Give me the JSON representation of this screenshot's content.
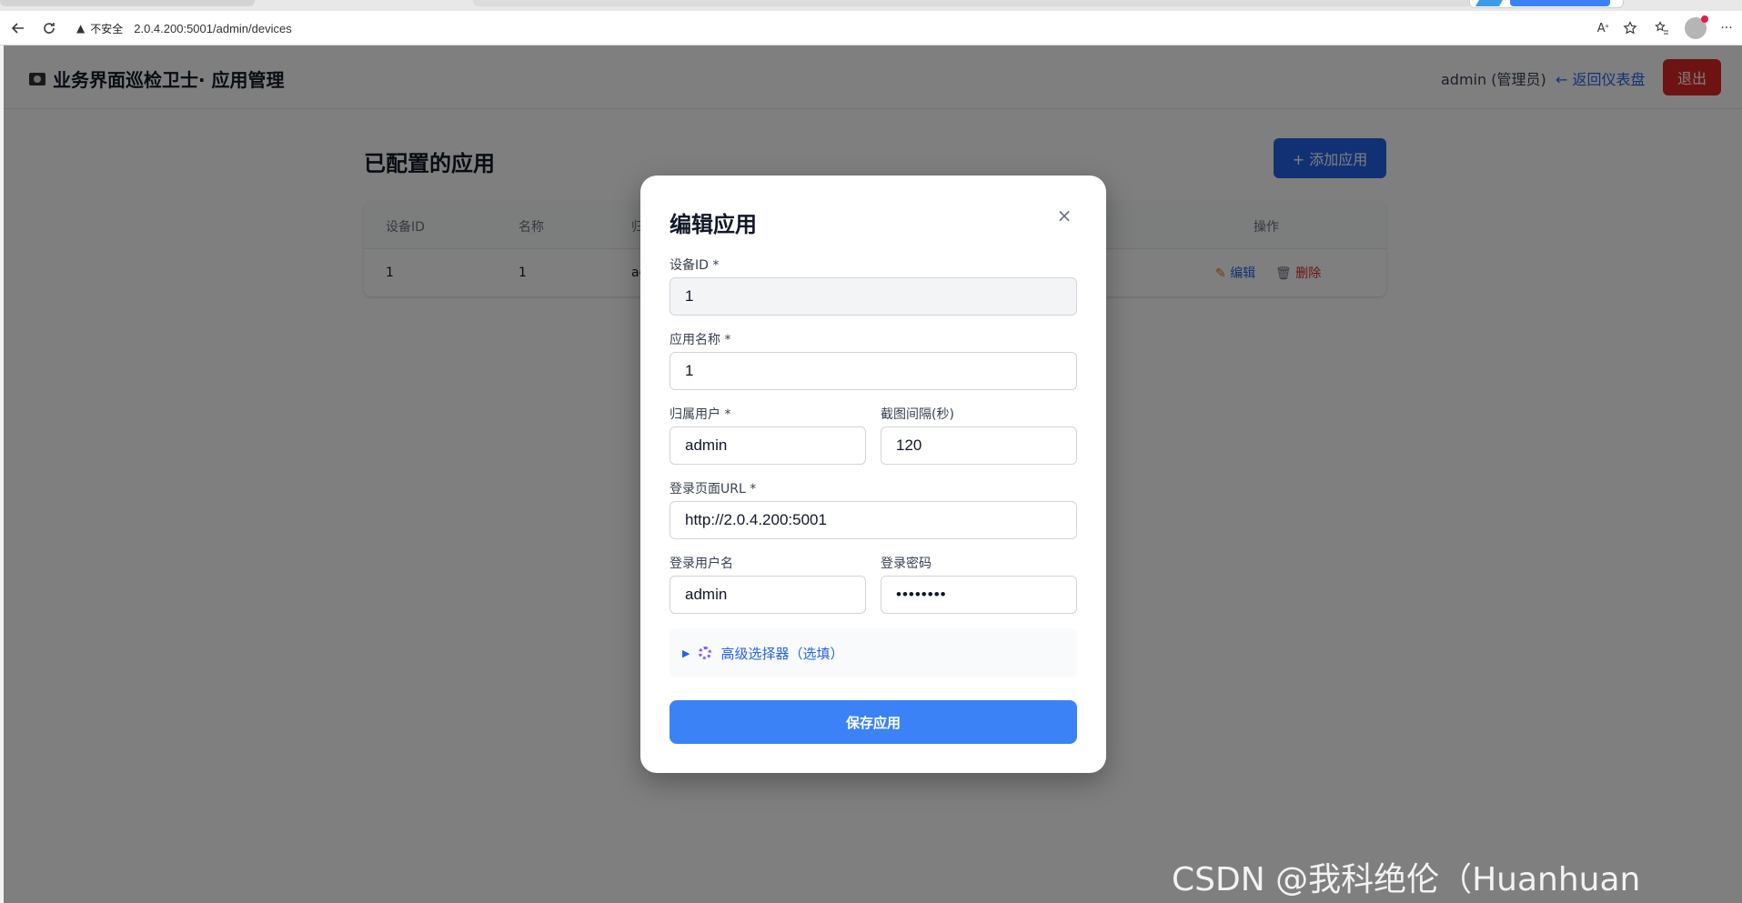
{
  "browser": {
    "security_label": "不安全",
    "url": "2.0.4.200:5001/admin/devices"
  },
  "header": {
    "app_title": "业务界面巡检卫士· 应用管理",
    "user": "admin (管理员)",
    "back_link": "← 返回仪表盘",
    "logout": "退出"
  },
  "main": {
    "section_title": "已配置的应用",
    "add_button": "+ 添加应用",
    "table": {
      "columns": [
        "设备ID",
        "名称",
        "归",
        "操作"
      ],
      "rows": [
        {
          "device_id": "1",
          "name": "1",
          "owner": "ac",
          "edit": "编辑",
          "delete": "删除"
        }
      ]
    }
  },
  "modal": {
    "title": "编辑应用",
    "close": "×",
    "device_id_label": "设备ID *",
    "device_id_value": "1",
    "app_name_label": "应用名称 *",
    "app_name_value": "1",
    "owner_label": "归属用户 *",
    "owner_value": "admin",
    "interval_label": "截图间隔(秒)",
    "interval_value": "120",
    "login_url_label": "登录页面URL *",
    "login_url_value": "http://2.0.4.200:5001",
    "login_user_label": "登录用户名",
    "login_user_value": "admin",
    "login_pass_label": "登录密码",
    "login_pass_value": "••••••••",
    "advanced_label": "高级选择器（选填）",
    "save_button": "保存应用"
  },
  "watermark": "CSDN @我科绝伦（Huanhuan Zhou）",
  "colors": {
    "primary": "#3b82f6",
    "danger": "#dc2626",
    "link": "#2563eb"
  }
}
